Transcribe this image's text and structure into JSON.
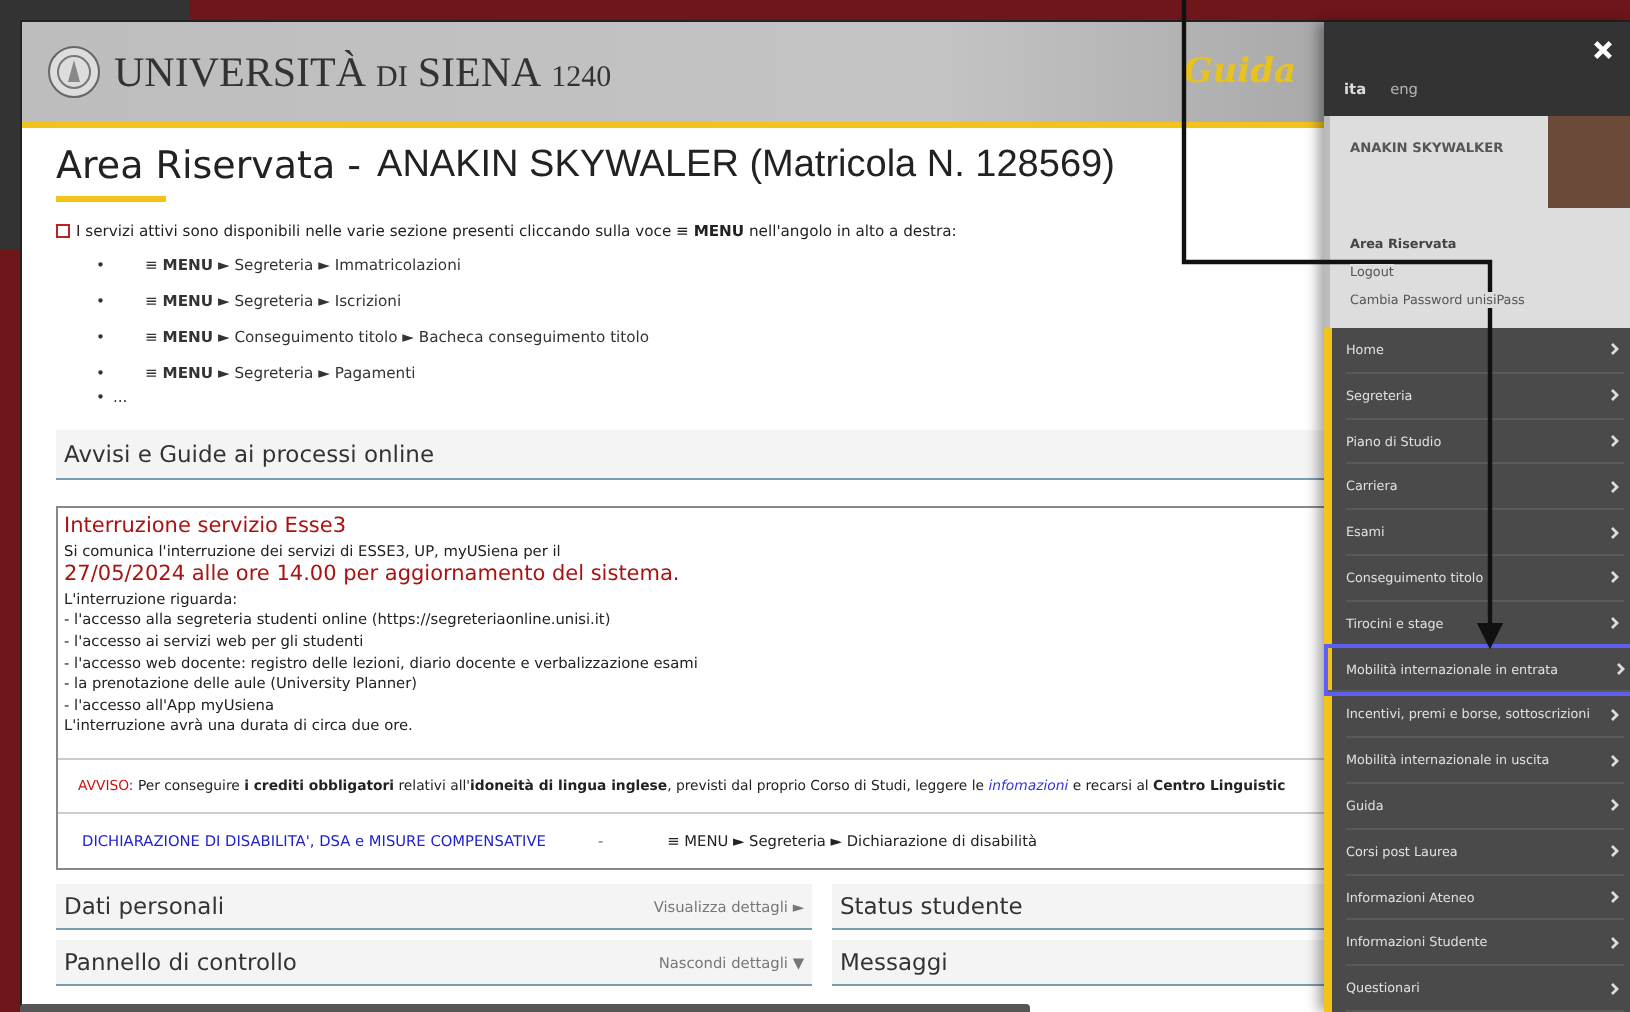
{
  "header": {
    "logo": {
      "main": "UNIVERSITÀ",
      "small": "DI",
      "city": "SIENA",
      "year": "1240"
    },
    "guide_label": "Guida"
  },
  "title": {
    "prefix": "Area Riservata -",
    "name": "ANAKIN SKYWALER (Matricola N. 128569)"
  },
  "intro": "I servizi attivi sono disponibili nelle varie sezione presenti cliccando sulla voce ≡ **MENU** nell'angolo in alto a destra:",
  "paths": [
    {
      "bullet": "•",
      "text": "≡ **MENU** ► Segreteria ► Immatricolazioni"
    },
    {
      "bullet": "•",
      "text": "≡ **MENU** ► Segreteria ► Iscrizioni"
    },
    {
      "bullet": "•",
      "text": "≡ **MENU** ► Conseguimento titolo ► Bacheca conseguimento titolo"
    },
    {
      "bullet": "•",
      "text": "≡ **MENU** ► Segreteria ► Pagamenti"
    },
    {
      "bullet": "•",
      "text": "..."
    }
  ],
  "notices": {
    "title": "Avvisi e Guide ai processi online",
    "notice": {
      "title": "Interruzione servizio Esse3",
      "lead": "Si comunica l'interruzione dei servizi di ESSE3, UP, myUSiena per il",
      "date": "27/05/2024 alle ore 14.00 per aggiornamento del sistema.",
      "lines": [
        "L'interruzione riguarda:",
        "- l'accesso alla segreteria studenti online (https://segreteriaonline.unisi.it)",
        "- l'accesso ai servizi web per gli studenti",
        "- l'accesso web docente: registro delle lezioni, diario docente e verbalizzazione esami",
        "- la prenotazione delle aule (University Planner)",
        "- l'accesso all'App myUsiena",
        "L'interruzione avrà una durata di circa due ore."
      ]
    },
    "warning": {
      "label": "AVVISO:",
      "before": "Per conseguire **i crediti obbligatori** relativi all'**idoneità di lingua inglese**, previsti dal proprio Corso di Studi, leggere le",
      "link": "infomazioni",
      "after": "e recarsi al **Centro Linguistic**"
    },
    "disability": {
      "link": "DICHIARAZIONE DI DISABILITA', DSA e MISURE COMPENSATIVE",
      "separator": "-",
      "path": "≡ MENU ► Segreteria ► Dichiarazione di disabilità"
    }
  },
  "panels": [
    {
      "title": "Dati personali",
      "action": "Visualizza dettagli",
      "action_icon": "►"
    },
    {
      "title": "Status studente"
    },
    {
      "title": "Pannello di controllo",
      "action": "Nascondi dettagli",
      "action_icon": "▼"
    },
    {
      "title": "Messaggi"
    }
  ],
  "sidebar": {
    "languages": [
      {
        "label": "ita",
        "selected": true
      },
      {
        "label": "eng",
        "selected": false
      }
    ],
    "user": "ANAKIN SKYWALKER",
    "section": "Area Riservata",
    "links": [
      "Logout",
      "Cambia Password unisiPass"
    ],
    "menu": [
      {
        "label": "Home",
        "highlighted": false
      },
      {
        "label": "Segreteria",
        "highlighted": false
      },
      {
        "label": "Piano di Studio",
        "highlighted": false
      },
      {
        "label": "Carriera",
        "highlighted": false
      },
      {
        "label": "Esami",
        "highlighted": false
      },
      {
        "label": "Conseguimento titolo",
        "highlighted": false
      },
      {
        "label": "Tirocini e stage",
        "highlighted": false
      },
      {
        "label": "Mobilità internazionale in entrata",
        "highlighted": true
      },
      {
        "label": "Incentivi, premi e borse, sottoscrizioni",
        "highlighted": false
      },
      {
        "label": "Mobilità internazionale in uscita",
        "highlighted": false
      },
      {
        "label": "Guida",
        "highlighted": false
      },
      {
        "label": "Corsi post Laurea",
        "highlighted": false
      },
      {
        "label": "Informazioni Ateneo",
        "highlighted": false
      },
      {
        "label": "Informazioni Studente",
        "highlighted": false
      },
      {
        "label": "Questionari",
        "highlighted": false
      }
    ]
  }
}
